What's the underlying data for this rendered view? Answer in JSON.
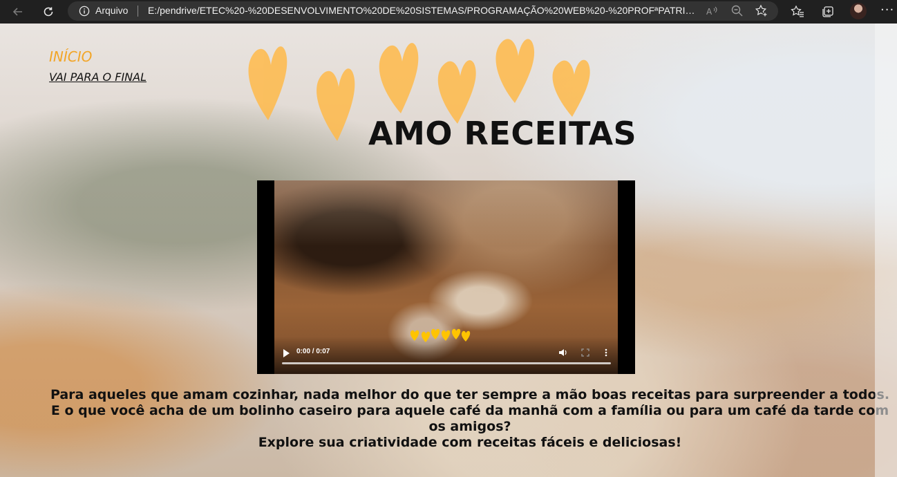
{
  "browser": {
    "site_label": "Arquivo",
    "url": "E:/pendrive/ETEC%20-%20DESENVOLVIMENTO%20DE%20SISTEMAS/PROGRAMAÇÃO%20WEB%20-%20PROFªPATRICIA/SEMES...",
    "icons": [
      "back-icon",
      "reload-icon",
      "info-icon",
      "read-aloud-icon",
      "zoom-icon",
      "add-favorite-icon",
      "favorites-icon",
      "collections-icon",
      "profile-avatar",
      "more-icon"
    ]
  },
  "page": {
    "nav": {
      "inicio": "INÍCIO",
      "final": "VAI PARA O FINAL"
    },
    "title": "AMO RECEITAS",
    "video": {
      "time": "0:00 / 0:07",
      "icons": [
        "play-icon",
        "volume-icon",
        "fullscreen-icon",
        "more-options-icon"
      ],
      "progress": 0
    },
    "paragraphs": [
      "Para aqueles que amam cozinhar, nada melhor do que ter sempre a mão boas receitas para surpreender a todos.",
      "E o que você acha de um bolinho caseiro para aquele café da manhã com a família ou para um café da tarde com os amigos?",
      "Explore sua criatividade com receitas fáceis e deliciosas!"
    ],
    "colors": {
      "accent": "#f2a527",
      "hearts": "#ffba4a"
    }
  }
}
